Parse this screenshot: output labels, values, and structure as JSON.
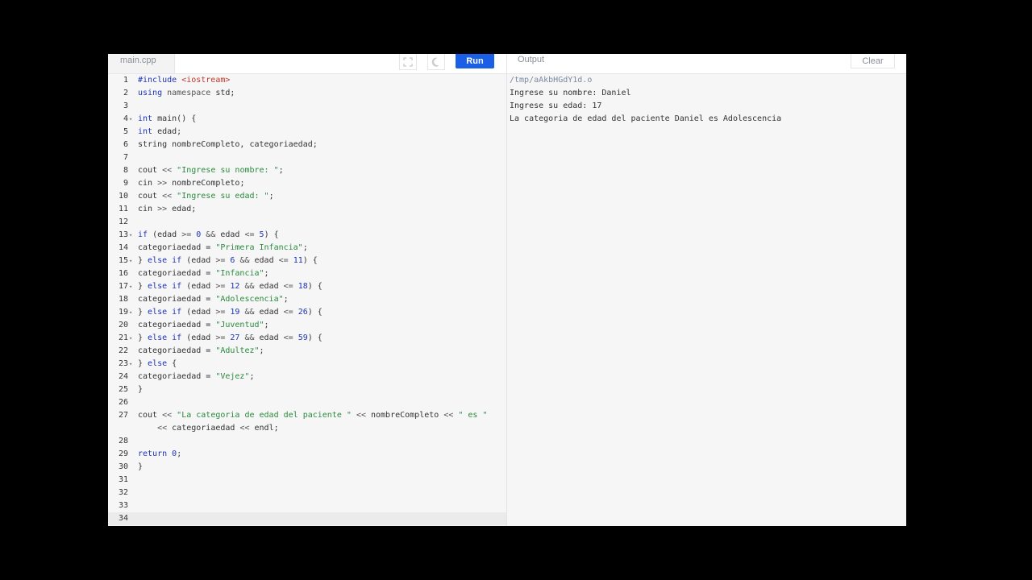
{
  "editor": {
    "file_tab": "main.cpp",
    "run_label": "Run",
    "fullscreen_icon": "fullscreen-icon",
    "theme_icon": "moon-icon",
    "current_line": 34,
    "lines": [
      {
        "n": "1",
        "fold": "",
        "tokens": [
          [
            "t-kw",
            "#include "
          ],
          [
            "t-inc",
            "<iostream>"
          ]
        ]
      },
      {
        "n": "2",
        "fold": "",
        "tokens": [
          [
            "t-kw",
            "using "
          ],
          [
            "t-op",
            "namespace "
          ],
          [
            "",
            "std;"
          ]
        ]
      },
      {
        "n": "3",
        "fold": "",
        "tokens": []
      },
      {
        "n": "4",
        "fold": "▾",
        "tokens": [
          [
            "t-kw",
            "int "
          ],
          [
            "",
            "main() {"
          ]
        ]
      },
      {
        "n": "5",
        "fold": "",
        "tokens": [
          [
            "t-kw",
            "int "
          ],
          [
            "",
            "edad;"
          ]
        ]
      },
      {
        "n": "6",
        "fold": "",
        "tokens": [
          [
            "",
            "string nombreCompleto, categoriaedad;"
          ]
        ]
      },
      {
        "n": "7",
        "fold": "",
        "tokens": []
      },
      {
        "n": "8",
        "fold": "",
        "tokens": [
          [
            "",
            "cout "
          ],
          [
            "t-op",
            "<< "
          ],
          [
            "t-str",
            "\"Ingrese su nombre: \""
          ],
          [
            "",
            ";"
          ]
        ]
      },
      {
        "n": "9",
        "fold": "",
        "tokens": [
          [
            "",
            "cin "
          ],
          [
            "t-op",
            ">> "
          ],
          [
            "",
            "nombreCompleto;"
          ]
        ]
      },
      {
        "n": "10",
        "fold": "",
        "tokens": [
          [
            "",
            "cout "
          ],
          [
            "t-op",
            "<< "
          ],
          [
            "t-str",
            "\"Ingrese su edad: \""
          ],
          [
            "",
            ";"
          ]
        ]
      },
      {
        "n": "11",
        "fold": "",
        "tokens": [
          [
            "",
            "cin "
          ],
          [
            "t-op",
            ">> "
          ],
          [
            "",
            "edad;"
          ]
        ]
      },
      {
        "n": "12",
        "fold": "",
        "tokens": []
      },
      {
        "n": "13",
        "fold": "▾",
        "tokens": [
          [
            "t-kw",
            "if "
          ],
          [
            "",
            "(edad "
          ],
          [
            "t-op",
            ">= "
          ],
          [
            "t-num",
            "0 "
          ],
          [
            "t-op",
            "&& "
          ],
          [
            "",
            "edad "
          ],
          [
            "t-op",
            "<= "
          ],
          [
            "t-num",
            "5"
          ],
          [
            "",
            ") {"
          ]
        ]
      },
      {
        "n": "14",
        "fold": "",
        "tokens": [
          [
            "",
            "categoriaedad = "
          ],
          [
            "t-str",
            "\"Primera Infancia\""
          ],
          [
            "",
            ";"
          ]
        ]
      },
      {
        "n": "15",
        "fold": "▾",
        "tokens": [
          [
            "",
            "} "
          ],
          [
            "t-kw",
            "else if "
          ],
          [
            "",
            "(edad "
          ],
          [
            "t-op",
            ">= "
          ],
          [
            "t-num",
            "6 "
          ],
          [
            "t-op",
            "&& "
          ],
          [
            "",
            "edad "
          ],
          [
            "t-op",
            "<= "
          ],
          [
            "t-num",
            "11"
          ],
          [
            "",
            ") {"
          ]
        ]
      },
      {
        "n": "16",
        "fold": "",
        "tokens": [
          [
            "",
            "categoriaedad = "
          ],
          [
            "t-str",
            "\"Infancia\""
          ],
          [
            "",
            ";"
          ]
        ]
      },
      {
        "n": "17",
        "fold": "▾",
        "tokens": [
          [
            "",
            "} "
          ],
          [
            "t-kw",
            "else if "
          ],
          [
            "",
            "(edad "
          ],
          [
            "t-op",
            ">= "
          ],
          [
            "t-num",
            "12 "
          ],
          [
            "t-op",
            "&& "
          ],
          [
            "",
            "edad "
          ],
          [
            "t-op",
            "<= "
          ],
          [
            "t-num",
            "18"
          ],
          [
            "",
            ") {"
          ]
        ]
      },
      {
        "n": "18",
        "fold": "",
        "tokens": [
          [
            "",
            "categoriaedad = "
          ],
          [
            "t-str",
            "\"Adolescencia\""
          ],
          [
            "",
            ";"
          ]
        ]
      },
      {
        "n": "19",
        "fold": "▾",
        "tokens": [
          [
            "",
            "} "
          ],
          [
            "t-kw",
            "else if "
          ],
          [
            "",
            "(edad "
          ],
          [
            "t-op",
            ">= "
          ],
          [
            "t-num",
            "19 "
          ],
          [
            "t-op",
            "&& "
          ],
          [
            "",
            "edad "
          ],
          [
            "t-op",
            "<= "
          ],
          [
            "t-num",
            "26"
          ],
          [
            "",
            ") {"
          ]
        ]
      },
      {
        "n": "20",
        "fold": "",
        "tokens": [
          [
            "",
            "categoriaedad = "
          ],
          [
            "t-str",
            "\"Juventud\""
          ],
          [
            "",
            ";"
          ]
        ]
      },
      {
        "n": "21",
        "fold": "▾",
        "tokens": [
          [
            "",
            "} "
          ],
          [
            "t-kw",
            "else if "
          ],
          [
            "",
            "(edad "
          ],
          [
            "t-op",
            ">= "
          ],
          [
            "t-num",
            "27 "
          ],
          [
            "t-op",
            "&& "
          ],
          [
            "",
            "edad "
          ],
          [
            "t-op",
            "<= "
          ],
          [
            "t-num",
            "59"
          ],
          [
            "",
            ") {"
          ]
        ]
      },
      {
        "n": "22",
        "fold": "",
        "tokens": [
          [
            "",
            "categoriaedad = "
          ],
          [
            "t-str",
            "\"Adultez\""
          ],
          [
            "",
            ";"
          ]
        ]
      },
      {
        "n": "23",
        "fold": "▾",
        "tokens": [
          [
            "",
            "} "
          ],
          [
            "t-kw",
            "else "
          ],
          [
            "",
            "{"
          ]
        ]
      },
      {
        "n": "24",
        "fold": "",
        "tokens": [
          [
            "",
            "categoriaedad = "
          ],
          [
            "t-str",
            "\"Vejez\""
          ],
          [
            "",
            ";"
          ]
        ]
      },
      {
        "n": "25",
        "fold": "",
        "tokens": [
          [
            "",
            "}"
          ]
        ]
      },
      {
        "n": "26",
        "fold": "",
        "tokens": []
      },
      {
        "n": "27",
        "fold": "",
        "tokens": [
          [
            "",
            "cout "
          ],
          [
            "t-op",
            "<< "
          ],
          [
            "t-str",
            "\"La categoria de edad del paciente \" "
          ],
          [
            "t-op",
            "<< "
          ],
          [
            "",
            "nombreCompleto "
          ],
          [
            "t-op",
            "<< "
          ],
          [
            "t-str",
            "\" es \""
          ]
        ]
      },
      {
        "n": "",
        "fold": "",
        "tokens": [
          [
            "",
            "    "
          ],
          [
            "t-op",
            "<< "
          ],
          [
            "",
            "categoriaedad "
          ],
          [
            "t-op",
            "<< "
          ],
          [
            "",
            "endl;"
          ]
        ]
      },
      {
        "n": "28",
        "fold": "",
        "tokens": []
      },
      {
        "n": "29",
        "fold": "",
        "tokens": [
          [
            "t-kw",
            "return "
          ],
          [
            "t-num",
            "0"
          ],
          [
            "",
            ";"
          ]
        ]
      },
      {
        "n": "30",
        "fold": "",
        "tokens": [
          [
            "",
            "}"
          ]
        ]
      },
      {
        "n": "31",
        "fold": "",
        "tokens": []
      },
      {
        "n": "32",
        "fold": "",
        "tokens": []
      },
      {
        "n": "33",
        "fold": "",
        "tokens": []
      },
      {
        "n": "34",
        "fold": "",
        "tokens": []
      }
    ]
  },
  "output": {
    "title": "Output",
    "clear_label": "Clear",
    "lines": [
      {
        "text": "/tmp/aAkbHGdY1d.o",
        "kind": "path"
      },
      {
        "text": "Ingrese su nombre: Daniel",
        "kind": "text"
      },
      {
        "text": "Ingrese su edad: 17",
        "kind": "text"
      },
      {
        "text": "La categoria de edad del paciente Daniel es Adolescencia",
        "kind": "text"
      }
    ]
  }
}
